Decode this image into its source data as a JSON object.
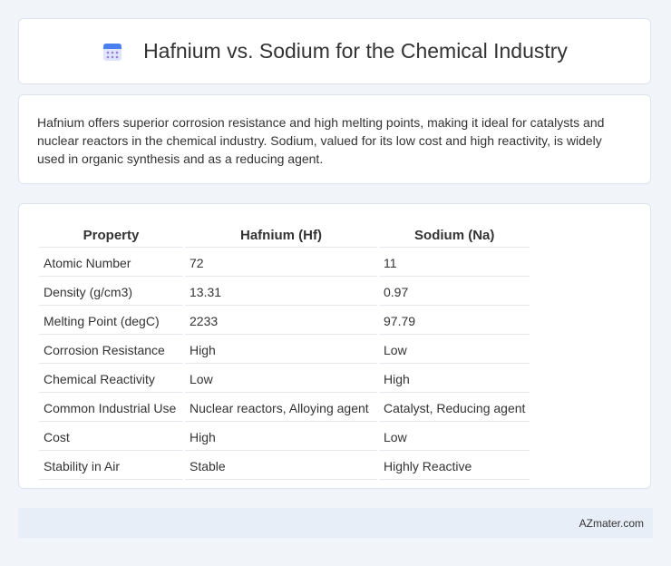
{
  "header": {
    "title": "Hafnium vs. Sodium for the Chemical Industry",
    "icon": "calendar-icon"
  },
  "intro": {
    "text": "Hafnium offers superior corrosion resistance and high melting points, making it ideal for catalysts and nuclear reactors in the chemical industry. Sodium, valued for its low cost and high reactivity, is widely used in organic synthesis and as a reducing agent."
  },
  "table": {
    "headers": [
      "Property",
      "Hafnium (Hf)",
      "Sodium (Na)"
    ],
    "rows": [
      [
        "Atomic Number",
        "72",
        "11"
      ],
      [
        "Density (g/cm3)",
        "13.31",
        "0.97"
      ],
      [
        "Melting Point (degC)",
        "2233",
        "97.79"
      ],
      [
        "Corrosion Resistance",
        "High",
        "Low"
      ],
      [
        "Chemical Reactivity",
        "Low",
        "High"
      ],
      [
        "Common Industrial Use",
        "Nuclear reactors, Alloying agent",
        "Catalyst, Reducing agent"
      ],
      [
        "Cost",
        "High",
        "Low"
      ],
      [
        "Stability in Air",
        "Stable",
        "Highly Reactive"
      ]
    ]
  },
  "footer": {
    "brand": "AZmater.com"
  }
}
